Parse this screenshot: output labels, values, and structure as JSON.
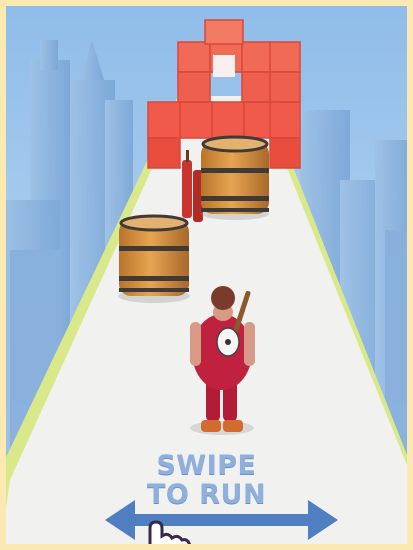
{
  "game": {
    "tutorial": {
      "line1": "SWIPE",
      "line2": "TO RUN"
    }
  },
  "colors": {
    "sky": "#a9cdf0",
    "track": "#f1f1ef",
    "track_edge": "#d9e98a",
    "wall_block": "#ef5a4a",
    "barrel": "#d3913c",
    "character_outfit": "#c0213e",
    "arrow": "#4f7fc0"
  }
}
